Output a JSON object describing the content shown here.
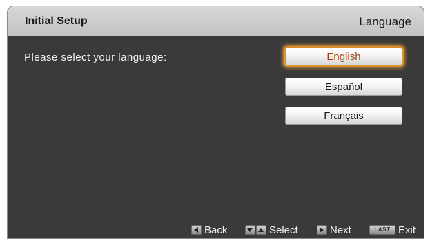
{
  "header": {
    "title": "Initial Setup",
    "section": "Language"
  },
  "prompt": "Please select your language:",
  "languages": [
    {
      "label": "English",
      "selected": true
    },
    {
      "label": "Español",
      "selected": false
    },
    {
      "label": "Français",
      "selected": false
    }
  ],
  "footer": {
    "back_label": "Back",
    "select_label": "Select",
    "next_label": "Next",
    "exit_key_label": "LAST",
    "exit_label": "Exit"
  },
  "colors": {
    "panel_bg": "#3a3a3a",
    "header_bg": "#cfcfcf",
    "selected_text": "#a3420e",
    "selected_glow": "#f0a030"
  },
  "icons": [
    "left-arrow-key-icon",
    "down-arrow-key-icon",
    "up-arrow-key-icon",
    "right-arrow-key-icon",
    "last-key-icon"
  ]
}
